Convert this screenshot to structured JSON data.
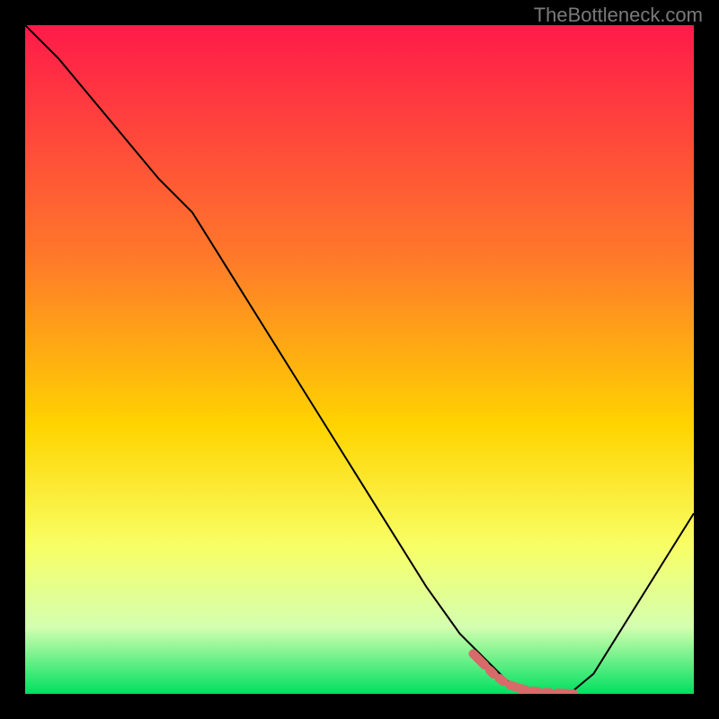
{
  "watermark": "TheBottleneck.com",
  "chart_data": {
    "type": "line",
    "title": "",
    "xlabel": "",
    "ylabel": "",
    "xlim": [
      0,
      100
    ],
    "ylim": [
      0,
      100
    ],
    "gradient_stops": [
      {
        "offset": 0,
        "color": "#ff1a4a"
      },
      {
        "offset": 35,
        "color": "#ff7a2a"
      },
      {
        "offset": 60,
        "color": "#ffd400"
      },
      {
        "offset": 78,
        "color": "#f8ff66"
      },
      {
        "offset": 90,
        "color": "#d4ffb0"
      },
      {
        "offset": 100,
        "color": "#00e060"
      }
    ],
    "series": [
      {
        "name": "bottleneck-curve",
        "stroke": "#000000",
        "stroke_width": 2,
        "x": [
          0,
          5,
          10,
          15,
          20,
          25,
          30,
          35,
          40,
          45,
          50,
          55,
          60,
          65,
          70,
          72,
          75,
          78,
          80,
          82,
          85,
          90,
          95,
          100
        ],
        "y": [
          100,
          95,
          89,
          83,
          77,
          72,
          64,
          56,
          48,
          40,
          32,
          24,
          16,
          9,
          4,
          2,
          0.5,
          0,
          0,
          0.5,
          3,
          11,
          19,
          27
        ]
      },
      {
        "name": "highlight-segment",
        "stroke": "#d86a6a",
        "stroke_width": 10,
        "dash": "18 8 6 8 6 8",
        "linecap": "round",
        "x": [
          67,
          70,
          72,
          74,
          76,
          78,
          80,
          82
        ],
        "y": [
          6,
          3,
          1.5,
          0.8,
          0.4,
          0.2,
          0.1,
          0
        ]
      }
    ]
  }
}
